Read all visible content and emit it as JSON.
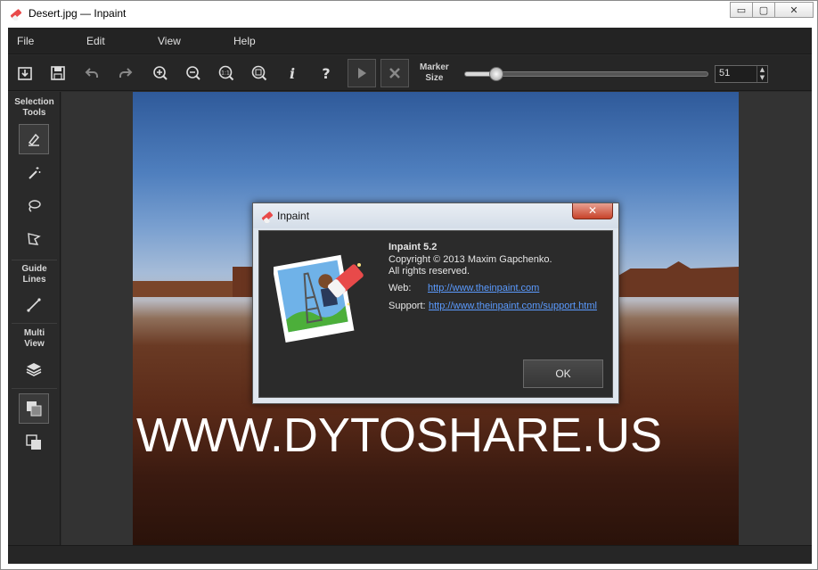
{
  "window": {
    "title": "Desert.jpg — Inpaint",
    "minimize_glyph": "▭",
    "maximize_glyph": "▢",
    "close_glyph": "✕"
  },
  "menu": {
    "items": [
      {
        "label": "File"
      },
      {
        "label": "Edit"
      },
      {
        "label": "View"
      },
      {
        "label": "Help"
      }
    ]
  },
  "toolbar": {
    "icons": [
      "open-icon",
      "save-icon",
      "undo-icon",
      "redo-icon",
      "zoom-in-icon",
      "zoom-out-icon",
      "actual-size-icon",
      "fit-window-icon",
      "info-icon",
      "help-icon",
      "run-icon",
      "cancel-icon"
    ],
    "info_glyph": "i",
    "help_glyph": "?",
    "actual_size_glyph": "1:1",
    "marker_size_label_1": "Marker",
    "marker_size_label_2": "Size",
    "marker_size_value": "51",
    "marker_size_fraction": 0.13
  },
  "sidebar": {
    "selection_title_1": "Selection",
    "selection_title_2": "Tools",
    "guide_title_1": "Guide",
    "guide_title_2": "Lines",
    "multi_title_1": "Multi",
    "multi_title_2": "View"
  },
  "canvas": {
    "watermark": "WWW.DYTOSHARE.US"
  },
  "dialog": {
    "title": "Inpaint",
    "close_glyph": "✕",
    "product": "Inpaint 5.2",
    "copyright": "Copyright © 2013 Maxim Gapchenko.",
    "rights": "All rights reserved.",
    "web_label": "Web:",
    "web_link": "http://www.theinpaint.com",
    "support_label": "Support:",
    "support_link": "http://www.theinpaint.com/support.html",
    "ok_label": "OK"
  },
  "colors": {
    "app_bg": "#2b2b2b",
    "link": "#5b9bff",
    "close_red": "#c7432a"
  }
}
